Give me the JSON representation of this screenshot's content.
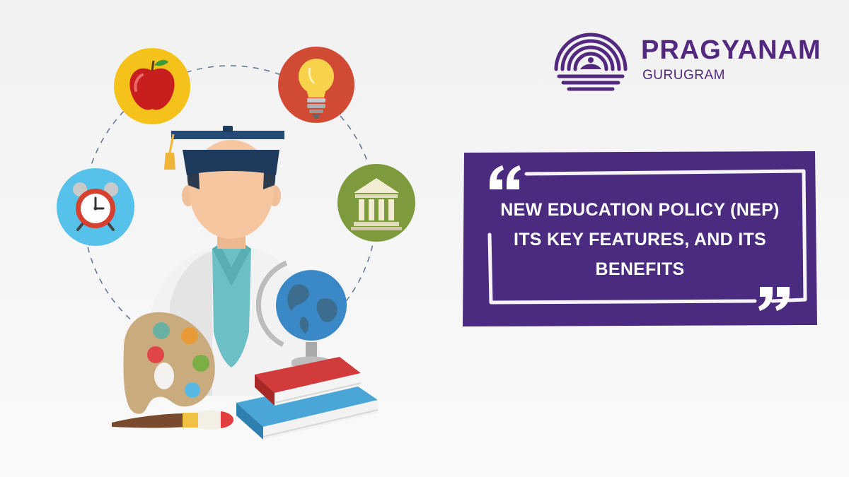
{
  "brand": {
    "name": "PRAGYANAM",
    "location": "GURUGRAM"
  },
  "headline": {
    "lines": [
      "NEW EDUCATION POLICY (NEP)",
      "ITS KEY FEATURES, AND ITS",
      "BENEFITS"
    ]
  },
  "colors": {
    "brand_purple": "#53287f",
    "banner_purple": "#4a2b7f",
    "apple_bg": "#f5c21b",
    "bulb_bg": "#d04a34",
    "clock_bg": "#56c1ea",
    "museum_bg": "#7d9a3c"
  },
  "icons": [
    "apple-icon",
    "lightbulb-icon",
    "alarm-clock-icon",
    "institution-icon",
    "graduate-icon",
    "globe-icon",
    "books-icon",
    "palette-icon",
    "paintbrush-icon",
    "quote-open-icon",
    "quote-close-icon"
  ]
}
